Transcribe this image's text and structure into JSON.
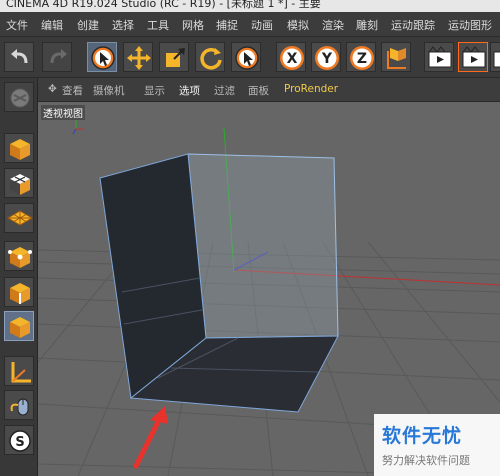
{
  "window": {
    "title": "CINEMA 4D R19.024 Studio (RC - R19) - [未标题 1 *] - 主要"
  },
  "menu": {
    "items": [
      "文件",
      "编辑",
      "创建",
      "选择",
      "工具",
      "网格",
      "捕捉",
      "动画",
      "模拟",
      "渲染",
      "雕刻",
      "运动跟踪",
      "运动图形"
    ]
  },
  "viewport_menu": {
    "items": [
      "查看",
      "摄像机",
      "显示",
      "选项",
      "过滤",
      "面板",
      "ProRender"
    ],
    "active": "选项"
  },
  "viewport": {
    "label": "透视视图"
  },
  "axis_buttons": {
    "x": "X",
    "y": "Y",
    "z": "Z"
  },
  "watermark": {
    "title": "软件无忧",
    "subtitle": "努力解决软件问题"
  },
  "colors": {
    "accent": "#f1c94b",
    "selection": "#ff6a1a",
    "arrow": "#e8322c",
    "brand": "#2878d8"
  },
  "icons": [
    "undo-icon",
    "redo-icon",
    "select-tool-icon",
    "move-tool-icon",
    "scale-tool-icon",
    "rotate-tool-icon",
    "live-select-icon",
    "x-axis-icon",
    "y-axis-icon",
    "z-axis-icon",
    "coordinate-system-icon",
    "render-view-icon",
    "render-to-picture-viewer-icon",
    "render-settings-icon",
    "make-editable-icon",
    "model-mode-icon",
    "texture-mode-icon",
    "workplane-mode-icon",
    "points-mode-icon",
    "edges-mode-icon",
    "polygons-mode-icon",
    "axis-mode-icon",
    "tweak-mode-icon",
    "snap-icon"
  ]
}
